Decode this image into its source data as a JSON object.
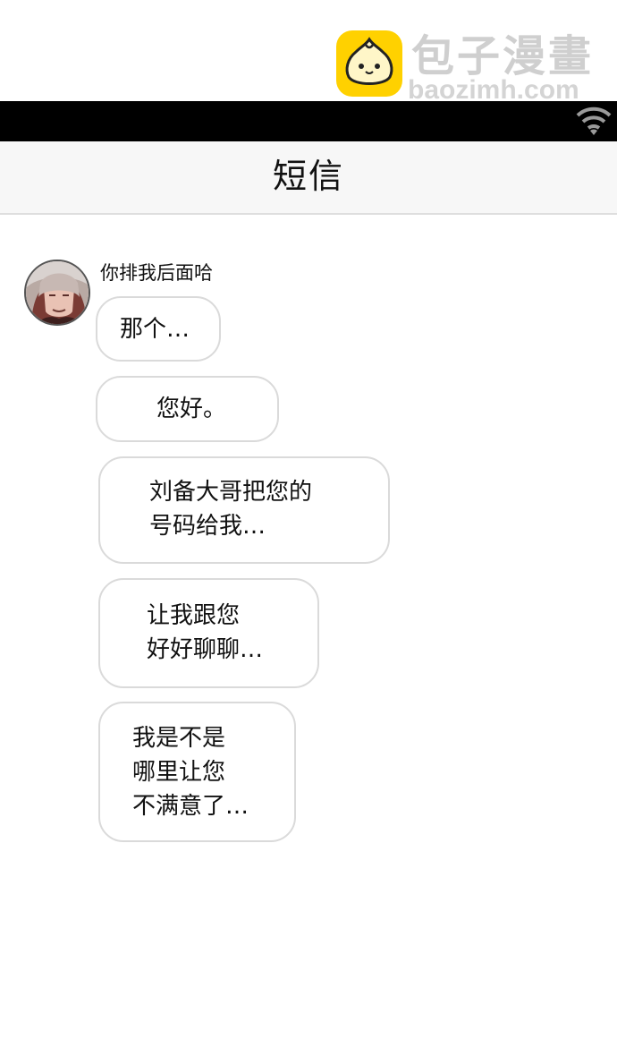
{
  "watermark": {
    "title": "包子漫畫",
    "url": "baozimh.com",
    "logo_icon": "bun-mascot-icon",
    "logo_color": "#ffd100"
  },
  "status_bar": {
    "wifi_icon": "wifi-icon"
  },
  "header": {
    "title": "短信"
  },
  "conversation": {
    "sender_name": "你排我后面哈",
    "avatar_icon": "contact-avatar",
    "messages": [
      {
        "text": "那个…"
      },
      {
        "text": "您好。"
      },
      {
        "text": "刘备大哥把您的\n号码给我…"
      },
      {
        "text": "让我跟您\n好好聊聊…"
      },
      {
        "text": "我是不是\n哪里让您\n不满意了…"
      }
    ]
  }
}
